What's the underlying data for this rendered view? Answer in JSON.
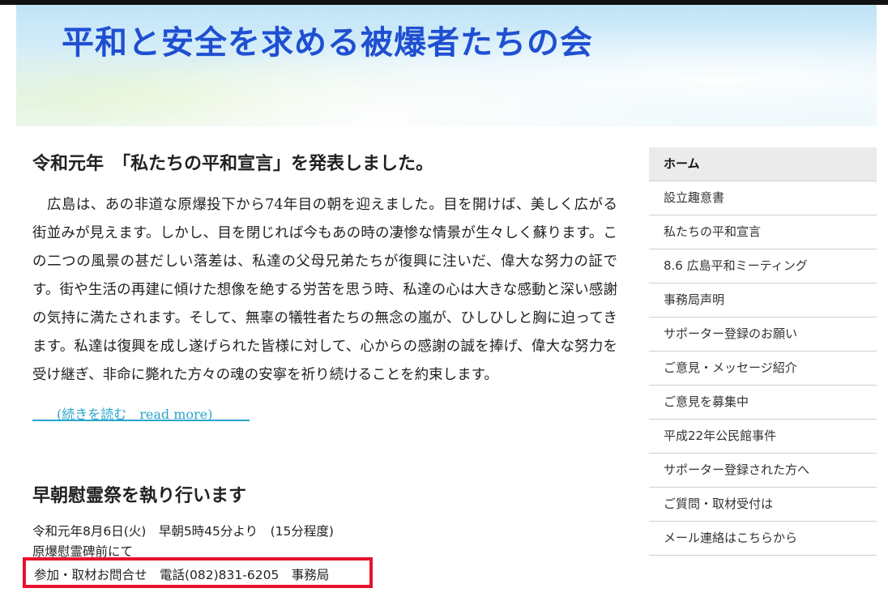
{
  "header": {
    "site_title": "平和と安全を求める被爆者たちの会"
  },
  "article": {
    "title": "令和元年　「私たちの平和宣言」を発表しました。",
    "body": "　広島は、あの非道な原爆投下から74年目の朝を迎えました。目を開けば、美しく広がる街並みが見えます。しかし、目を閉じれば今もあの時の凄惨な情景が生々しく蘇ります。この二つの風景の甚だしい落差は、私達の父母兄弟たちが復興に注いだ、偉大な努力の証です。街や生活の再建に傾けた想像を絶する労苦を思う時、私達の心は大きな感動と深い感謝の気持に満たされます。そして、無辜の犠牲者たちの無念の嵐が、ひしひしと胸に迫ってきます。私達は復興を成し遂げられた皆様に対して、心からの感謝の誠を捧げ、偉大な努力を受け継ぎ、非命に斃れた方々の魂の安寧を祈り続けることを約束します。",
    "read_more": "(続きを読む　read more)"
  },
  "event": {
    "title": "早朝慰霊祭を執り行います",
    "date_line": "令和元年8月6日(火)　早朝5時45分より　(15分程度)",
    "place_line": "原爆慰霊碑前にて",
    "contact_line": "参加・取材お問合せ　電話(082)831-6205　事務局"
  },
  "sidebar": {
    "items": [
      {
        "label": "ホーム"
      },
      {
        "label": "設立趣意書"
      },
      {
        "label": "私たちの平和宣言"
      },
      {
        "label": "8.6 広島平和ミーティング"
      },
      {
        "label": "事務局声明"
      },
      {
        "label": "サポーター登録のお願い"
      },
      {
        "label": "ご意見・メッセージ紹介"
      },
      {
        "label": "ご意見を募集中"
      },
      {
        "label": "平成22年公民館事件"
      },
      {
        "label": "サポーター登録された方へ"
      },
      {
        "label": "ご質問・取材受付は"
      },
      {
        "label": "メール連絡はこちらから"
      }
    ]
  },
  "colors": {
    "title_blue": "#1f4fd1",
    "link_cyan": "#2aa5cc",
    "highlight_red": "#e8122d",
    "nav_active_bg": "#ebebeb"
  }
}
